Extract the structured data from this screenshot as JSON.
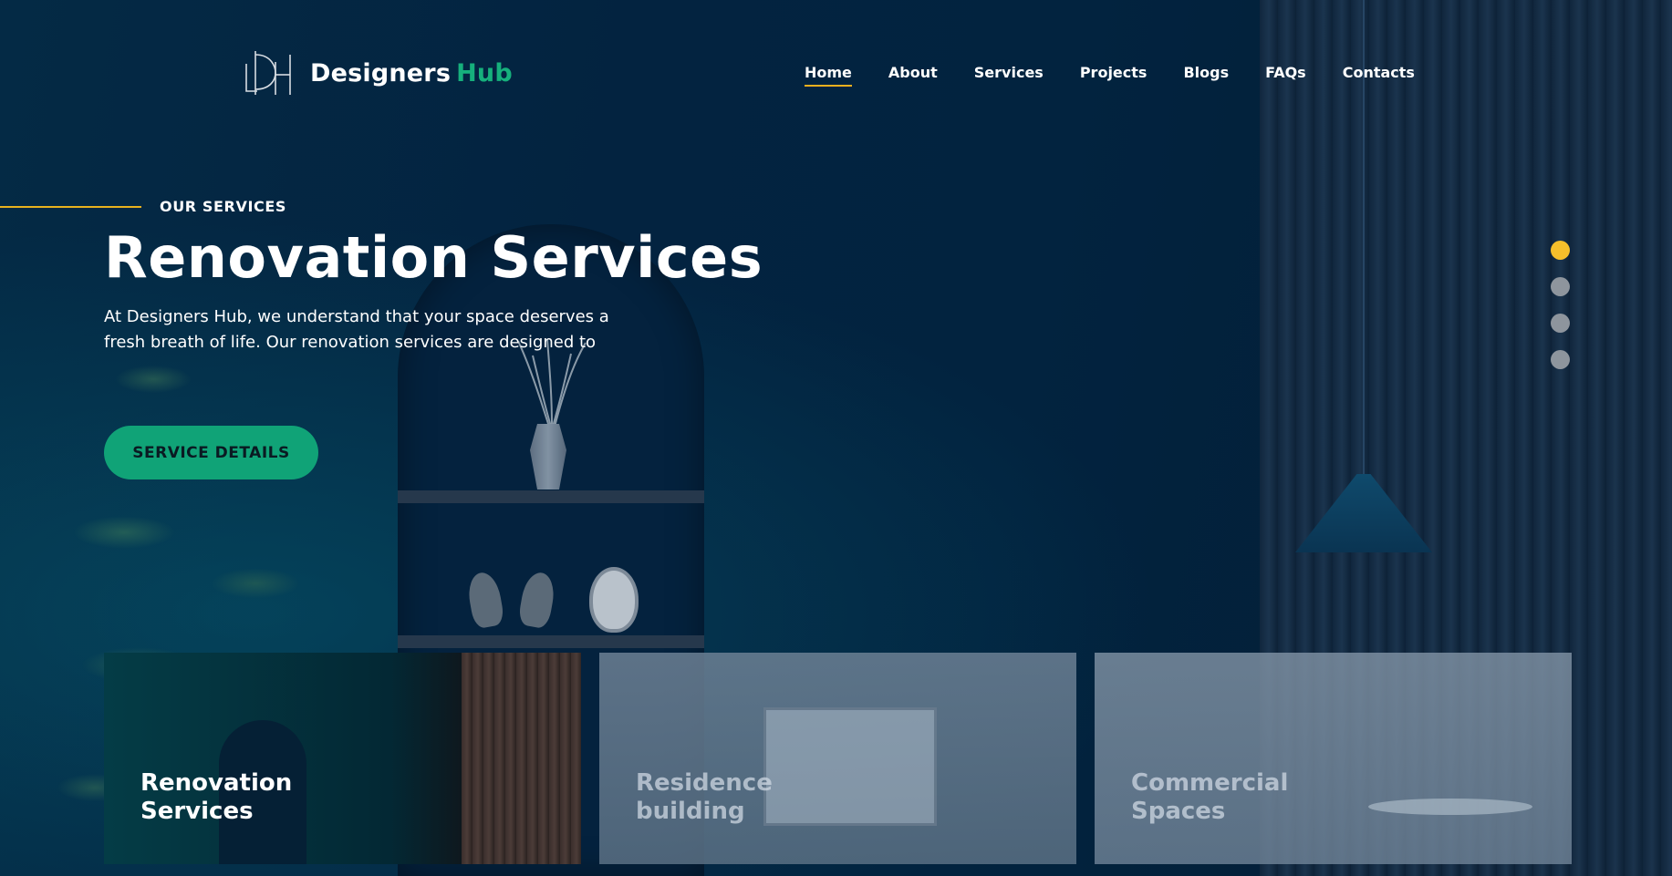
{
  "brand": {
    "logo_mark": "LDH",
    "name_primary": "Designers",
    "name_accent": "Hub",
    "accent_color": "#16b07c"
  },
  "nav": {
    "items": [
      {
        "label": "Home",
        "active": true
      },
      {
        "label": "About"
      },
      {
        "label": "Services"
      },
      {
        "label": "Projects"
      },
      {
        "label": "Blogs"
      },
      {
        "label": "FAQs"
      },
      {
        "label": "Contacts"
      }
    ],
    "active_underline_color": "#f2b01e"
  },
  "hero": {
    "eyebrow": "OUR SERVICES",
    "title": "Renovation Services",
    "description": "At Designers Hub, we understand that your space deserves a fresh breath of life. Our renovation services are designed to",
    "cta_label": "SERVICE DETAILS",
    "cta_color": "#10a377"
  },
  "slider": {
    "total": 4,
    "active_index": 0,
    "active_color": "#f5bf2b",
    "inactive_color": "#8e959d"
  },
  "cards": [
    {
      "title": "Renovation Services",
      "active": true
    },
    {
      "title": "Residence building",
      "active": false
    },
    {
      "title": "Commercial Spaces",
      "active": false
    }
  ]
}
